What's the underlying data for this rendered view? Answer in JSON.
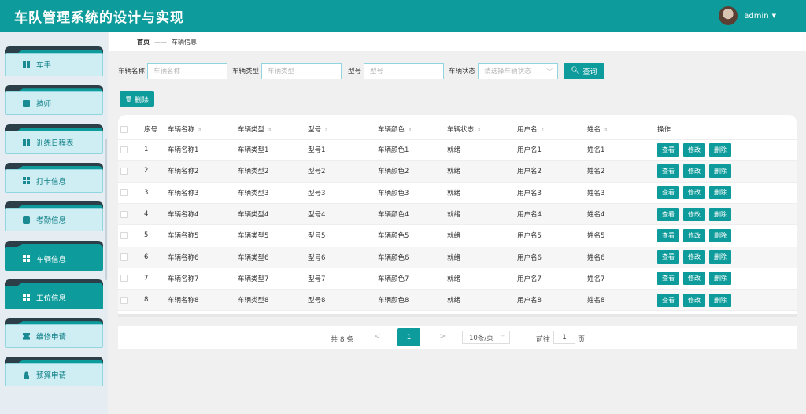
{
  "app": {
    "title": "车队管理系统的设计与实现",
    "user": "admin"
  },
  "sidebar": {
    "items": [
      {
        "label": "车手",
        "icon": "grid-icon"
      },
      {
        "label": "技师",
        "icon": "chart-icon"
      },
      {
        "label": "训练日程表",
        "icon": "grid-icon"
      },
      {
        "label": "打卡信息",
        "icon": "grid-icon"
      },
      {
        "label": "考勤信息",
        "icon": "briefcase-icon"
      },
      {
        "label": "车辆信息",
        "icon": "grid-icon",
        "active": true
      },
      {
        "label": "工位信息",
        "icon": "grid-icon",
        "active": true
      },
      {
        "label": "维修申请",
        "icon": "ticket-icon"
      },
      {
        "label": "预算申请",
        "icon": "user-icon"
      }
    ]
  },
  "breadcrumb": {
    "home": "首页",
    "separator": "——",
    "current": "车辆信息"
  },
  "search": {
    "fields": [
      {
        "label": "车辆名称",
        "placeholder": "车辆名称"
      },
      {
        "label": "车辆类型",
        "placeholder": "车辆类型"
      },
      {
        "label": "型号",
        "placeholder": "型号"
      },
      {
        "label": "车辆状态",
        "placeholder": "请选择车辆状态"
      }
    ],
    "query_label": "查询"
  },
  "toolbar": {
    "delete_label": "删除"
  },
  "table": {
    "headers": [
      "序号",
      "车辆名称",
      "车辆类型",
      "型号",
      "车辆颜色",
      "车辆状态",
      "用户名",
      "姓名",
      "操作"
    ],
    "rows": [
      [
        "1",
        "车辆名称1",
        "车辆类型1",
        "型号1",
        "车辆颜色1",
        "就绪",
        "用户名1",
        "姓名1"
      ],
      [
        "2",
        "车辆名称2",
        "车辆类型2",
        "型号2",
        "车辆颜色2",
        "就绪",
        "用户名2",
        "姓名2"
      ],
      [
        "3",
        "车辆名称3",
        "车辆类型3",
        "型号3",
        "车辆颜色3",
        "就绪",
        "用户名3",
        "姓名3"
      ],
      [
        "4",
        "车辆名称4",
        "车辆类型4",
        "型号4",
        "车辆颜色4",
        "就绪",
        "用户名4",
        "姓名4"
      ],
      [
        "5",
        "车辆名称5",
        "车辆类型5",
        "型号5",
        "车辆颜色5",
        "就绪",
        "用户名5",
        "姓名5"
      ],
      [
        "6",
        "车辆名称6",
        "车辆类型6",
        "型号6",
        "车辆颜色6",
        "就绪",
        "用户名6",
        "姓名6"
      ],
      [
        "7",
        "车辆名称7",
        "车辆类型7",
        "型号7",
        "车辆颜色7",
        "就绪",
        "用户名7",
        "姓名7"
      ],
      [
        "8",
        "车辆名称8",
        "车辆类型8",
        "型号8",
        "车辆颜色8",
        "就绪",
        "用户名8",
        "姓名8"
      ]
    ],
    "actions": [
      "查看",
      "修改",
      "删除"
    ]
  },
  "pagination": {
    "total": "共 8 条",
    "prev": "<",
    "current": "1",
    "next": ">",
    "page_size": "10条/页",
    "goto": "前往",
    "goto_value": "1",
    "goto_suffix": "页"
  },
  "colors": {
    "primary": "#0e9b9b"
  }
}
